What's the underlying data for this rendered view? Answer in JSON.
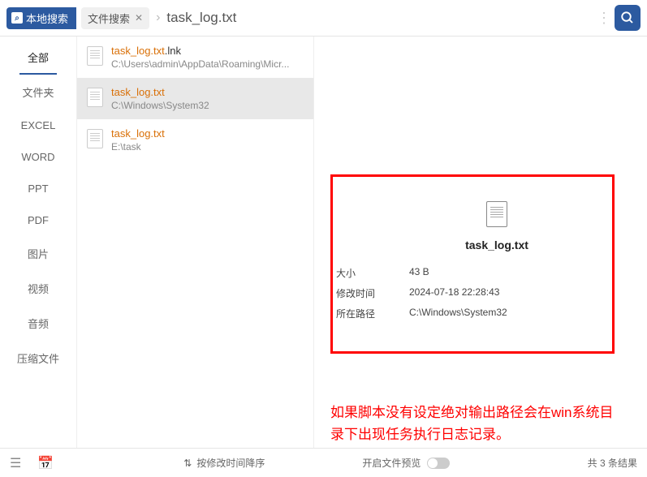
{
  "header": {
    "primary_tab": "本地搜索",
    "secondary_tab": "文件搜索",
    "search_query": "task_log.txt"
  },
  "sidebar": {
    "items": [
      {
        "label": "全部",
        "active": true
      },
      {
        "label": "文件夹"
      },
      {
        "label": "EXCEL"
      },
      {
        "label": "WORD"
      },
      {
        "label": "PPT"
      },
      {
        "label": "PDF"
      },
      {
        "label": "图片"
      },
      {
        "label": "视频"
      },
      {
        "label": "音频"
      },
      {
        "label": "压缩文件"
      }
    ]
  },
  "results": [
    {
      "name": "task_log.txt",
      "ext": ".lnk",
      "path": "C:\\Users\\admin\\AppData\\Roaming\\Micr...",
      "selected": false
    },
    {
      "name": "task_log.txt",
      "ext": "",
      "path": "C:\\Windows\\System32",
      "selected": true
    },
    {
      "name": "task_log.txt",
      "ext": "",
      "path": "E:\\task",
      "selected": false
    }
  ],
  "preview": {
    "filename": "task_log.txt",
    "details": [
      {
        "label": "大小",
        "value": "43 B"
      },
      {
        "label": "修改时间",
        "value": "2024-07-18 22:28:43"
      },
      {
        "label": "所在路径",
        "value": "C:\\Windows\\System32"
      }
    ]
  },
  "annotation": "如果脚本没有设定绝对输出路径会在win系统目录下出现任务执行日志记录。",
  "footer": {
    "sort_label": "按修改时间降序",
    "preview_label": "开启文件预览",
    "count_prefix": "共",
    "count": "3",
    "count_suffix": "条结果"
  }
}
